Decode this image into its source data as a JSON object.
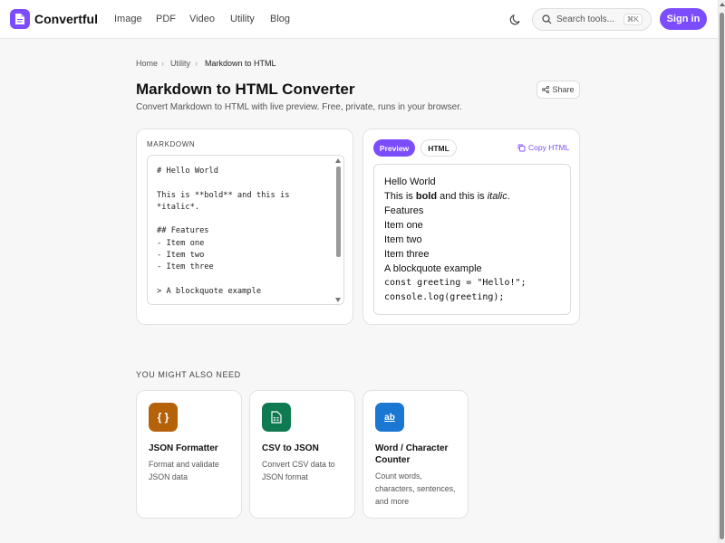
{
  "header": {
    "brand": "Convertful",
    "nav": [
      "Image",
      "PDF",
      "Video",
      "Utility",
      "Blog"
    ],
    "search_placeholder": "Search tools...",
    "search_shortcut": "⌘K",
    "signin_label": "Sign in",
    "accent_color": "#7c4dff"
  },
  "breadcrumb": [
    "Home",
    "Utility",
    "Markdown to HTML"
  ],
  "page": {
    "title": "Markdown to HTML Converter",
    "subtitle": "Convert Markdown to HTML with live preview. Free, private, runs in your browser.",
    "share_label": "Share"
  },
  "editor": {
    "label": "MARKDOWN",
    "content": "# Hello World\n\nThis is **bold** and this is\n*italic*.\n\n## Features\n- Item one\n- Item two\n- Item three\n\n> A blockquote example"
  },
  "output": {
    "tabs": [
      "Preview",
      "HTML"
    ],
    "copy_label": "Copy HTML",
    "preview": {
      "line1": "Hello World",
      "line2_pre": "This is ",
      "line2_bold": "bold",
      "line2_mid": " and this is ",
      "line2_italic": "italic",
      "line2_post": ".",
      "line3": "Features",
      "line4": "Item one",
      "line5": "Item two",
      "line6": "Item three",
      "line7": "A blockquote example",
      "code1": "const greeting = \"Hello!\";",
      "code2": "console.log(greeting);"
    }
  },
  "also": {
    "heading": "YOU MIGHT ALSO NEED",
    "cards": [
      {
        "icon": "braces-icon",
        "glyph": "{ }",
        "color": "#b5620a",
        "title": "JSON Formatter",
        "desc": "Format and validate JSON data"
      },
      {
        "icon": "spreadsheet-icon",
        "glyph": "",
        "color": "#0f7a52",
        "title": "CSV to JSON",
        "desc": "Convert CSV data to JSON format"
      },
      {
        "icon": "text-count-icon",
        "glyph": "ab",
        "color": "#1a78d2",
        "title": "Word / Character Counter",
        "desc": "Count words, characters, sentences, and more"
      }
    ]
  }
}
